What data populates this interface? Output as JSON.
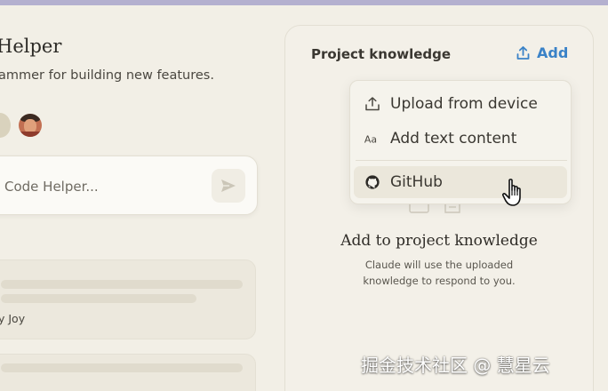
{
  "project": {
    "title": "Helper",
    "description": "ammer for building new features."
  },
  "chat": {
    "placeholder": "Code Helper..."
  },
  "conversation": {
    "author_text": "y Joy"
  },
  "knowledge_panel": {
    "title": "Project knowledge",
    "add_label": "Add",
    "menu": [
      {
        "icon": "upload-icon",
        "label": "Upload from device"
      },
      {
        "icon": "text-icon",
        "label": "Add text content"
      },
      {
        "icon": "github-icon",
        "label": "GitHub"
      }
    ],
    "empty_title": "Add to project knowledge",
    "empty_sub_line1": "Claude will use the uploaded",
    "empty_sub_line2": "knowledge  to respond to you."
  },
  "watermark": "掘金技术社区 @ 慧星云",
  "colors": {
    "accent": "#3a82c7",
    "background": "#f2efe6",
    "topbar": "#b4b0cf"
  }
}
